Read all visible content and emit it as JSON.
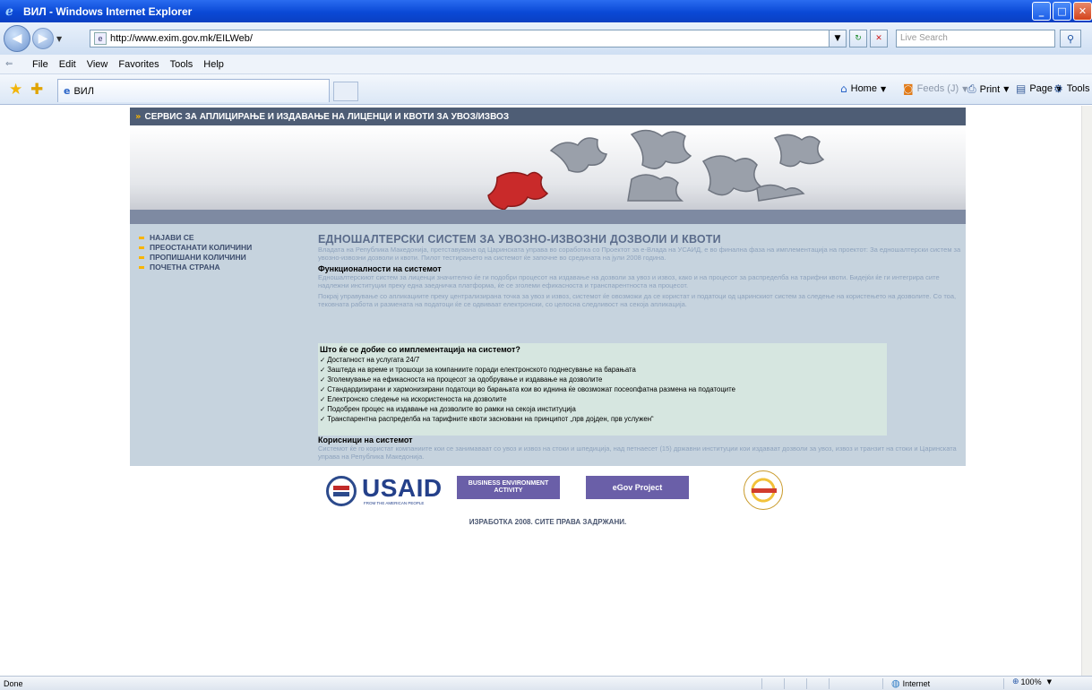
{
  "window": {
    "title": "ВИЛ - Windows Internet Explorer",
    "controls": {
      "minimize": "_",
      "maximize": "□",
      "close": "✕"
    }
  },
  "address_bar": {
    "url": "http://www.exim.gov.mk/EILWeb/",
    "search_placeholder": "Live Search"
  },
  "menu": {
    "items": [
      "File",
      "Edit",
      "View",
      "Favorites",
      "Tools",
      "Help"
    ]
  },
  "tab": {
    "label": "ВИЛ"
  },
  "command_bar": {
    "home": "Home",
    "feeds": "Feeds (J)",
    "print": "Print",
    "page": "Page",
    "tools": "Tools"
  },
  "site": {
    "header": "СЕРВИС ЗА АПЛИЦИРАЊЕ И ИЗДАВАЊЕ НА ЛИЦЕНЦИ И КВОТИ ЗА УВОЗ/ИЗВОЗ",
    "nav": [
      "НАЈАВИ СЕ",
      "ПРЕОСТАНАТИ КОЛИЧИНИ",
      "ПРОПИШАНИ КОЛИЧИНИ",
      "ПОЧЕТНА СТРАНА"
    ],
    "main_heading": "ЕДНОШАЛТЕРСКИ СИСТЕМ ЗА УВОЗНО-ИЗВОЗНИ ДОЗВОЛИ И КВОТИ",
    "intro_text": "Владата на Република Македонија, претставувана од Царинската управа во соработка со Проектот за е-Влада на УСАИД, е во финална фаза на имплементација на проектот: За еднoшалтерски систем за увозно-извозни дозволи и квоти. Пилот тестирањето на системот ќе започне во средината на јули 2008 година.",
    "functionality_heading": "Функционалности на системот",
    "functionality_text_1": "Еднoшалтерскиот систем за лиценци значително ќе ги подобри процесот на издавање на дозволи за увоз и извоз, како и на процесот за распределба на тарифни квоти. Бидејќи ќе ги интегрира сите надлежни институции преку една заедничка платформа, ќе се зголеми ефикасноста и транспарентноста на процесот.",
    "functionality_text_2": "Покрај управување со апликациите преку централизирана точка за увоз и извоз, системот ќе овозможи да се користат и податоци од царинскиот систем за следење на користењето на дозволите. Со тоа, тековната работа и размената на податоци ќе се одвиваат електронски, со целосна следливост на секоја апликација.",
    "benefits_heading": "Што ќе се добие со имплементација на системот?",
    "benefits": [
      "Достапност на услугата 24/7",
      "Заштеда на време и трошоци за компаниите поради електронското поднесување на барањата",
      "Зголемување на ефикасноста на процесот за одобрување и издавање на дозволите",
      "Стандардизирани и хармонизирани податоци во барањата кои во иднина ќе овозможат посеопфатна размена на податоците",
      "Електронско следење на искористеноста на дозволите",
      "Подобрен процес на издавање на дозволите во рамки на секоја институција",
      "Транспарентна распределба на тарифните квоти засновани на принципот „прв дојден, прв услужен“"
    ],
    "users_heading": "Корисници на системот",
    "users_text": "Системот ќе го користат компаниите кои се занимаваат со увоз и извоз на стоки и шпедиција, над петнаесет (15) државни институции кои издаваат дозволи за увоз, извоз и транзит на стоки и Царинската управа на Република Македонија.",
    "logos": {
      "usaid": "USAID",
      "usaid_tagline": "FROM THE AMERICAN PEOPLE",
      "bea": "BUSINESS ENVIRONMENT ACTIVITY",
      "egov": "eGov Project"
    },
    "footer": "ИЗРАБОТКА 2008. СИТЕ ПРАВА ЗАДРЖАНИ."
  },
  "status_bar": {
    "status": "Done",
    "zone": "Internet",
    "zoom": "100%"
  },
  "colors": {
    "titlebar": "#0a49d6",
    "site_header": "#4e5d75",
    "nav_bullet": "#f8b400",
    "content_bg": "#c6d3de",
    "benefits_bg": "#d6e6e0"
  }
}
